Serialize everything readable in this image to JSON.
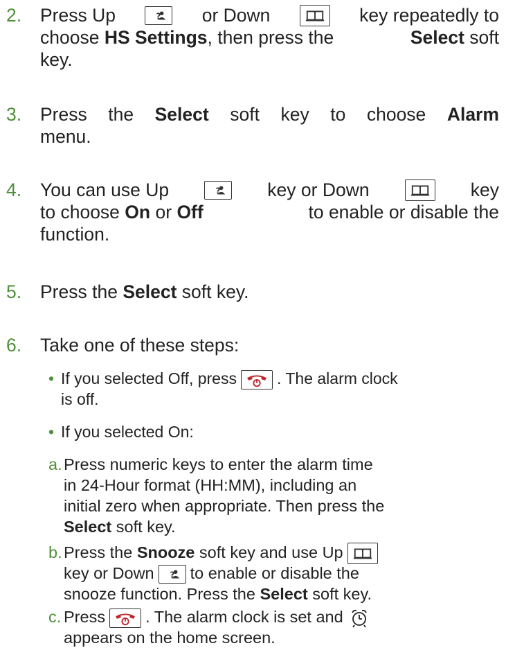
{
  "colors": {
    "step_number": "#4f8f3a",
    "text": "#222222",
    "end_key_red": "#c0262d"
  },
  "icons": {
    "up_key": "contacts-key-icon",
    "down_key": "phonebook-key-icon",
    "end_key": "end-call-power-key-icon",
    "alarm": "alarm-clock-icon"
  },
  "steps": [
    {
      "number": "2.",
      "l1_a": "Press Up",
      "l1_b": "or Down",
      "l1_c": "key repeatedly to",
      "l2_a": "choose",
      "l2_b": "HS Settings",
      "l2_c": ", then press the",
      "l2_d": "Select",
      "l2_e": "soft",
      "l3": "key."
    },
    {
      "number": "3.",
      "l1_a": "Press",
      "l1_b": "the",
      "l1_c": "Select",
      "l1_d": "soft",
      "l1_e": "key",
      "l1_f": "to",
      "l1_g": "choose",
      "l1_h": "Alarm",
      "l2": "menu."
    },
    {
      "number": "4.",
      "l1_a": "You can use Up",
      "l1_b": "key or Down",
      "l1_c": "key",
      "l2_a": "to choose",
      "l2_b": "On",
      "l2_c": "or",
      "l2_d": "Off",
      "l2_e": "to enable or disable the",
      "l3": "function."
    },
    {
      "number": "5.",
      "l1_a": "Press the",
      "l1_b": "Select",
      "l1_c": "soft key."
    },
    {
      "number": "6.",
      "l1": "Take one of these steps:"
    }
  ],
  "bullets": [
    {
      "dot": "•",
      "l1_a": "If you selected Off, press",
      "l1_b": ". The alarm clock",
      "l2": "is off."
    },
    {
      "dot": "•",
      "l1": "If you selected On:"
    }
  ],
  "substeps": [
    {
      "letter": "a.",
      "l1": "Press numeric keys to enter the alarm time",
      "l2": "in 24-Hour format (HH:MM), including an",
      "l3": "initial zero when appropriate. Then press the",
      "l4_a": "Select",
      "l4_b": "soft key."
    },
    {
      "letter": "b.",
      "l1_a": "Press the",
      "l1_b": "Snooze",
      "l1_c": "soft key and use Up",
      "l2_a": "key or Down",
      "l2_b": "to enable or disable the",
      "l3_a": "snooze function. Press the",
      "l3_b": "Select",
      "l3_c": "soft key."
    },
    {
      "letter": "c.",
      "l1_a": "Press",
      "l1_b": ". The alarm clock is set and",
      "l2": "appears on the home screen."
    }
  ]
}
